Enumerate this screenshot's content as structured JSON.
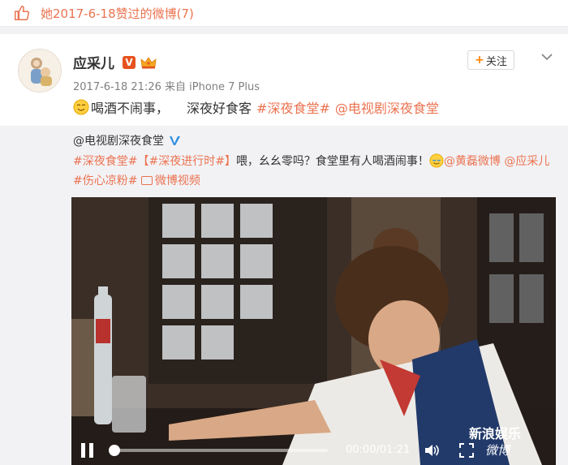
{
  "like_bar": {
    "text": "她2017-6-18赞过的微博(7)"
  },
  "post": {
    "author": "应采儿",
    "verified_badge": "V",
    "follow_label": "关注",
    "meta": "2017-6-18 21:26 来自 iPhone 7 Plus",
    "content": {
      "part1": "喝酒不闹事，",
      "part2": "深夜好食客",
      "tag": "#深夜食堂#",
      "mention": "@电视剧深夜食堂"
    }
  },
  "repost": {
    "author": "@电视剧深夜食堂",
    "tag1": "#深夜食堂#",
    "bracket": "【#深夜进行时#】",
    "text": "喂，幺幺零吗？食堂里有人喝酒闹事！",
    "mention1": "@黄磊微博",
    "mention2": "@应采儿",
    "tag2": "#伤心凉粉#",
    "video_link": "微博视频"
  },
  "video": {
    "time": "00:00/01:21",
    "progress": 0.0,
    "watermark_line1": "新浪娱乐",
    "watermark_line2": "微博"
  },
  "colors": {
    "accent": "#eb7350",
    "orange": "#ff8200",
    "bg_gray": "#f2f2f5"
  },
  "icons": [
    "thumbs-up-icon",
    "verified-icon",
    "crown-icon",
    "chevron-down-icon",
    "emoji-icon",
    "video-icon",
    "play-pause-icon",
    "volume-icon",
    "fullscreen-icon"
  ]
}
